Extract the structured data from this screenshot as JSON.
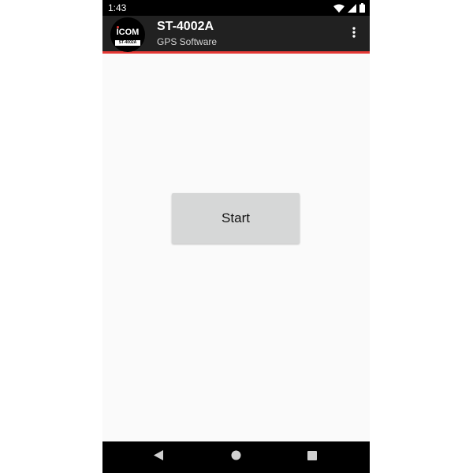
{
  "status_bar": {
    "time": "1:43",
    "icons": [
      "wifi-icon",
      "signal-icon",
      "battery-icon"
    ]
  },
  "app_bar": {
    "logo": {
      "brand": "ICOM",
      "model": "ST-4002A"
    },
    "title": "ST-4002A",
    "subtitle": "GPS Software",
    "menu_icon": "more-vert-icon",
    "accent_color": "#e53935",
    "background_color": "#212121"
  },
  "main": {
    "start_label": "Start",
    "button_color": "#d6d7d7",
    "background_color": "#fafafa"
  },
  "nav_bar": {
    "back_icon": "back-triangle-icon",
    "home_icon": "home-circle-icon",
    "recents_icon": "recents-square-icon"
  }
}
